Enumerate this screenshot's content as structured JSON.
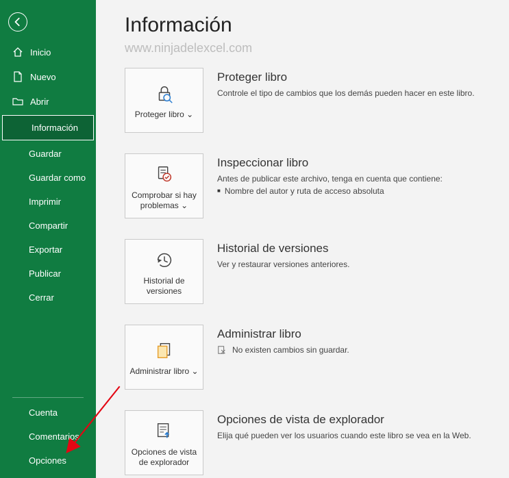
{
  "sidebar": {
    "home": "Inicio",
    "new": "Nuevo",
    "open": "Abrir",
    "info": "Información",
    "save": "Guardar",
    "saveAs": "Guardar como",
    "print": "Imprimir",
    "share": "Compartir",
    "export": "Exportar",
    "publish": "Publicar",
    "close": "Cerrar",
    "account": "Cuenta",
    "feedback": "Comentarios",
    "options": "Opciones"
  },
  "main": {
    "title": "Información",
    "watermark": "www.ninjadelexcel.com"
  },
  "sections": {
    "protect": {
      "tile": "Proteger libro ⌄",
      "heading": "Proteger libro",
      "text": "Controle el tipo de cambios que los demás pueden hacer en este libro."
    },
    "inspect": {
      "tile": "Comprobar si hay problemas ⌄",
      "heading": "Inspeccionar libro",
      "lead": "Antes de publicar este archivo, tenga en cuenta que contiene:",
      "item1": "Nombre del autor y ruta de acceso absoluta"
    },
    "versions": {
      "tile": "Historial de versiones",
      "heading": "Historial de versiones",
      "text": "Ver y restaurar versiones anteriores."
    },
    "manage": {
      "tile": "Administrar libro ⌄",
      "heading": "Administrar libro",
      "text": "No existen cambios sin guardar."
    },
    "browser": {
      "tile": "Opciones de vista de explorador",
      "heading": "Opciones de vista de explorador",
      "text": "Elija qué pueden ver los usuarios cuando este libro se vea en la Web."
    }
  }
}
